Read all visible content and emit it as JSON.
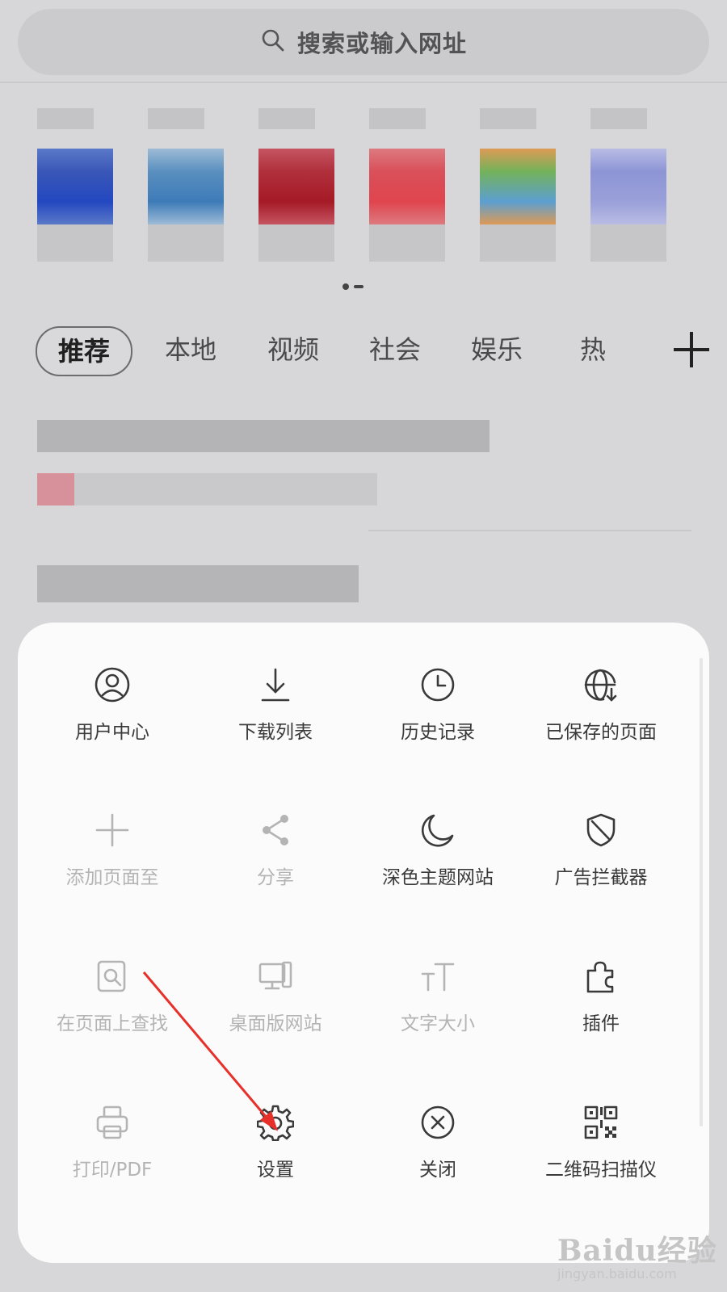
{
  "search": {
    "placeholder": "搜索或输入网址"
  },
  "shortcuts": [
    {
      "colors": [
        "#3a57b7",
        "#2348c0",
        "#5a79c8"
      ]
    },
    {
      "colors": [
        "#5a8fbf",
        "#3d7bb8",
        "#9dbbd6"
      ]
    },
    {
      "colors": [
        "#b0303c",
        "#a51a26",
        "#c55562"
      ]
    },
    {
      "colors": [
        "#d9505a",
        "#e0454e",
        "#dd7a80"
      ]
    },
    {
      "colors": [
        "#74b25a",
        "#5c9fd1",
        "#dd9a55"
      ]
    },
    {
      "colors": [
        "#8d95d6",
        "#9aa0d9",
        "#b9bce4"
      ]
    }
  ],
  "tabs": [
    "推荐",
    "本地",
    "视频",
    "社会",
    "娱乐",
    "热"
  ],
  "menu": [
    {
      "label": "用户中心",
      "icon": "user-center-icon",
      "disabled": false
    },
    {
      "label": "下载列表",
      "icon": "download-icon",
      "disabled": false
    },
    {
      "label": "历史记录",
      "icon": "history-clock-icon",
      "disabled": false
    },
    {
      "label": "已保存的页面",
      "icon": "saved-page-globe-icon",
      "disabled": false
    },
    {
      "label": "添加页面至",
      "icon": "plus-icon",
      "disabled": true
    },
    {
      "label": "分享",
      "icon": "share-icon",
      "disabled": true
    },
    {
      "label": "深色主题网站",
      "icon": "moon-icon",
      "disabled": false
    },
    {
      "label": "广告拦截器",
      "icon": "shield-icon",
      "disabled": false
    },
    {
      "label": "在页面上查找",
      "icon": "find-in-page-icon",
      "disabled": true
    },
    {
      "label": "桌面版网站",
      "icon": "desktop-icon",
      "disabled": true
    },
    {
      "label": "文字大小",
      "icon": "text-size-icon",
      "disabled": true
    },
    {
      "label": "插件",
      "icon": "puzzle-plugin-icon",
      "disabled": false
    },
    {
      "label": "打印/PDF",
      "icon": "printer-icon",
      "disabled": true
    },
    {
      "label": "设置",
      "icon": "gear-icon",
      "disabled": false
    },
    {
      "label": "关闭",
      "icon": "close-circle-icon",
      "disabled": false
    },
    {
      "label": "二维码扫描仪",
      "icon": "qr-code-icon",
      "disabled": false
    }
  ],
  "watermark": {
    "brand": "Baidu经验",
    "url": "jingyan.baidu.com"
  },
  "colors": {
    "arrow": "#e8302a",
    "icon": "#3a3a3a",
    "disabled": "#b4b4b4"
  }
}
